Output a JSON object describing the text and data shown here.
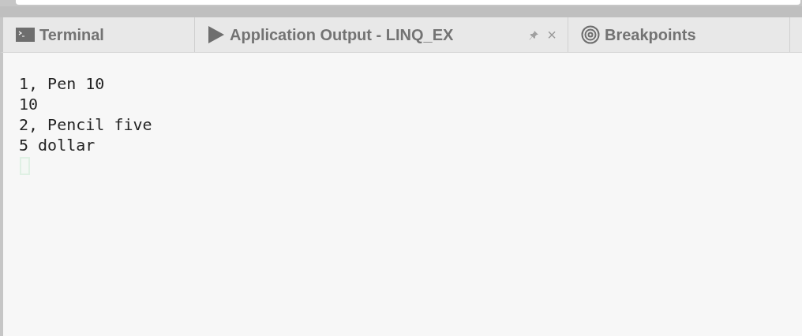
{
  "tabs": [
    {
      "kind": "terminal",
      "label": "Terminal"
    },
    {
      "kind": "output",
      "label": "Application Output - LINQ_EX",
      "pin": true,
      "close": "×"
    },
    {
      "kind": "breakpoints",
      "label": "Breakpoints"
    }
  ],
  "output": {
    "lines": [
      "1, Pen 10",
      "10",
      "2, Pencil five",
      "5 dollar"
    ],
    "cursor": true
  }
}
